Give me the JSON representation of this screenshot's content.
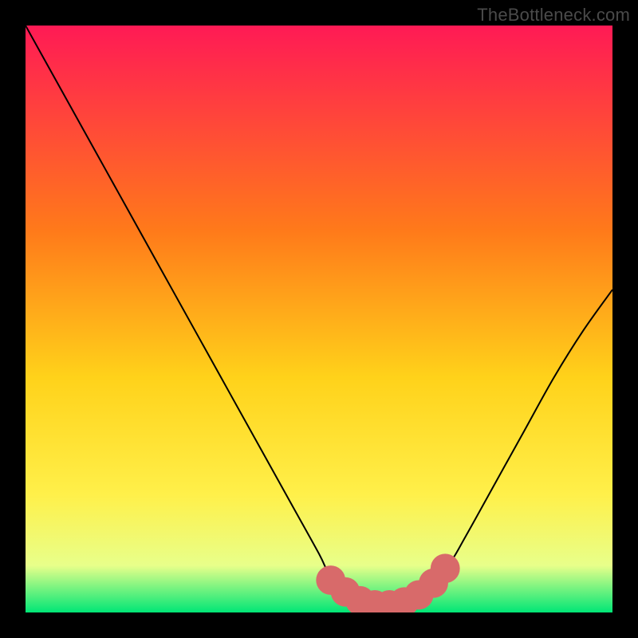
{
  "watermark": "TheBottleneck.com",
  "colors": {
    "gradient_top": "#ff1a55",
    "gradient_mid1": "#ff7a1a",
    "gradient_mid2": "#ffd21a",
    "gradient_mid3": "#fff04a",
    "gradient_mid4": "#e8ff8a",
    "gradient_bottom": "#00e676",
    "curve": "#000000",
    "marker": "#d86a6a"
  },
  "chart_data": {
    "type": "line",
    "title": "",
    "xlabel": "",
    "ylabel": "",
    "xlim": [
      0,
      100
    ],
    "ylim": [
      0,
      100
    ],
    "series": [
      {
        "name": "bottleneck-curve",
        "x": [
          0,
          5,
          10,
          15,
          20,
          25,
          30,
          35,
          40,
          45,
          50,
          52,
          55,
          58,
          60,
          63,
          65,
          68,
          72,
          75,
          80,
          85,
          90,
          95,
          100
        ],
        "y": [
          100,
          91,
          82,
          73,
          64,
          55,
          46,
          37,
          28,
          19,
          10,
          6,
          3,
          1,
          1,
          1,
          2,
          4,
          8,
          13,
          22,
          31,
          40,
          48,
          55
        ]
      }
    ],
    "markers": {
      "name": "highlight-dots",
      "x": [
        52,
        54.5,
        57,
        59.5,
        62,
        64.5,
        67,
        69.5,
        71.5
      ],
      "y": [
        5.5,
        3.5,
        2.0,
        1.3,
        1.3,
        1.8,
        3.0,
        5.0,
        7.5
      ],
      "radius": 2.5
    }
  }
}
